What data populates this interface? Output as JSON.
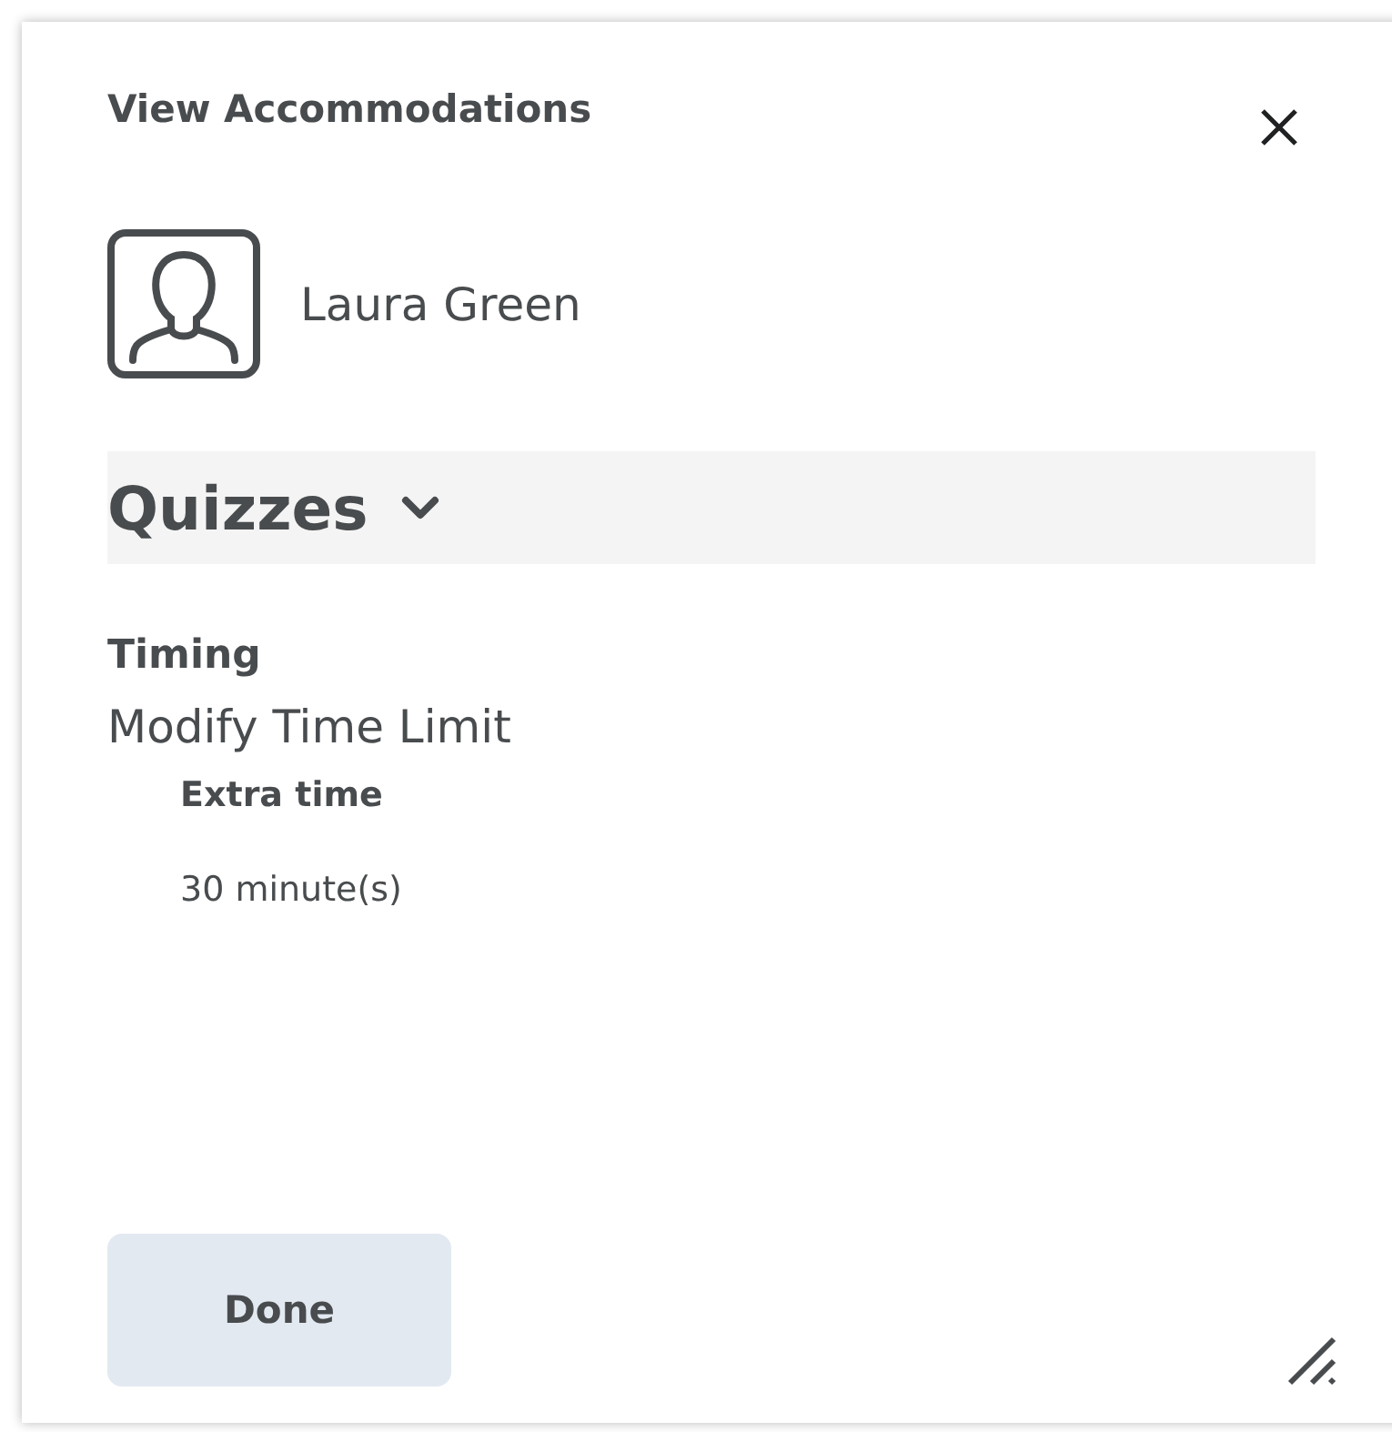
{
  "dialog": {
    "title": "View Accommodations"
  },
  "user": {
    "name": "Laura Green"
  },
  "section": {
    "title": "Quizzes",
    "expanded": true
  },
  "category": {
    "title": "Timing",
    "accommodation": "Modify Time Limit",
    "detail_label": "Extra time",
    "detail_value": "30 minute(s)"
  },
  "buttons": [
    "Done"
  ]
}
